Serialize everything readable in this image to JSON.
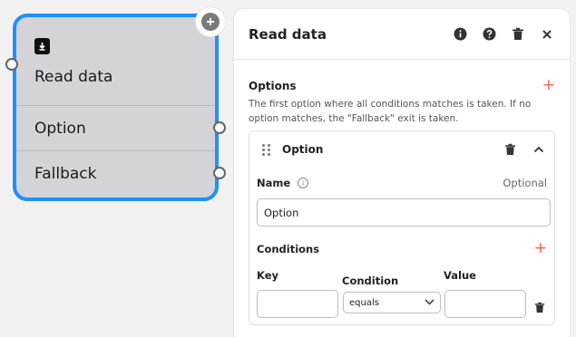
{
  "node": {
    "title": "Read data",
    "outputs": [
      "Option",
      "Fallback"
    ]
  },
  "panel": {
    "title": "Read data",
    "options_section": {
      "title": "Options",
      "description": "The first option where all conditions matches is taken. If no option matches, the \"Fallback\" exit is taken."
    },
    "option": {
      "title": "Option",
      "name_label": "Name",
      "optional_text": "Optional",
      "name_value": "Option",
      "conditions_label": "Conditions",
      "key_label": "Key",
      "condition_label": "Condition",
      "value_label": "Value",
      "condition_selected": "equals",
      "key_value": "",
      "value_value": ""
    }
  },
  "colors": {
    "accent_border": "#1e90ff",
    "add_plus": "#f0614a"
  }
}
